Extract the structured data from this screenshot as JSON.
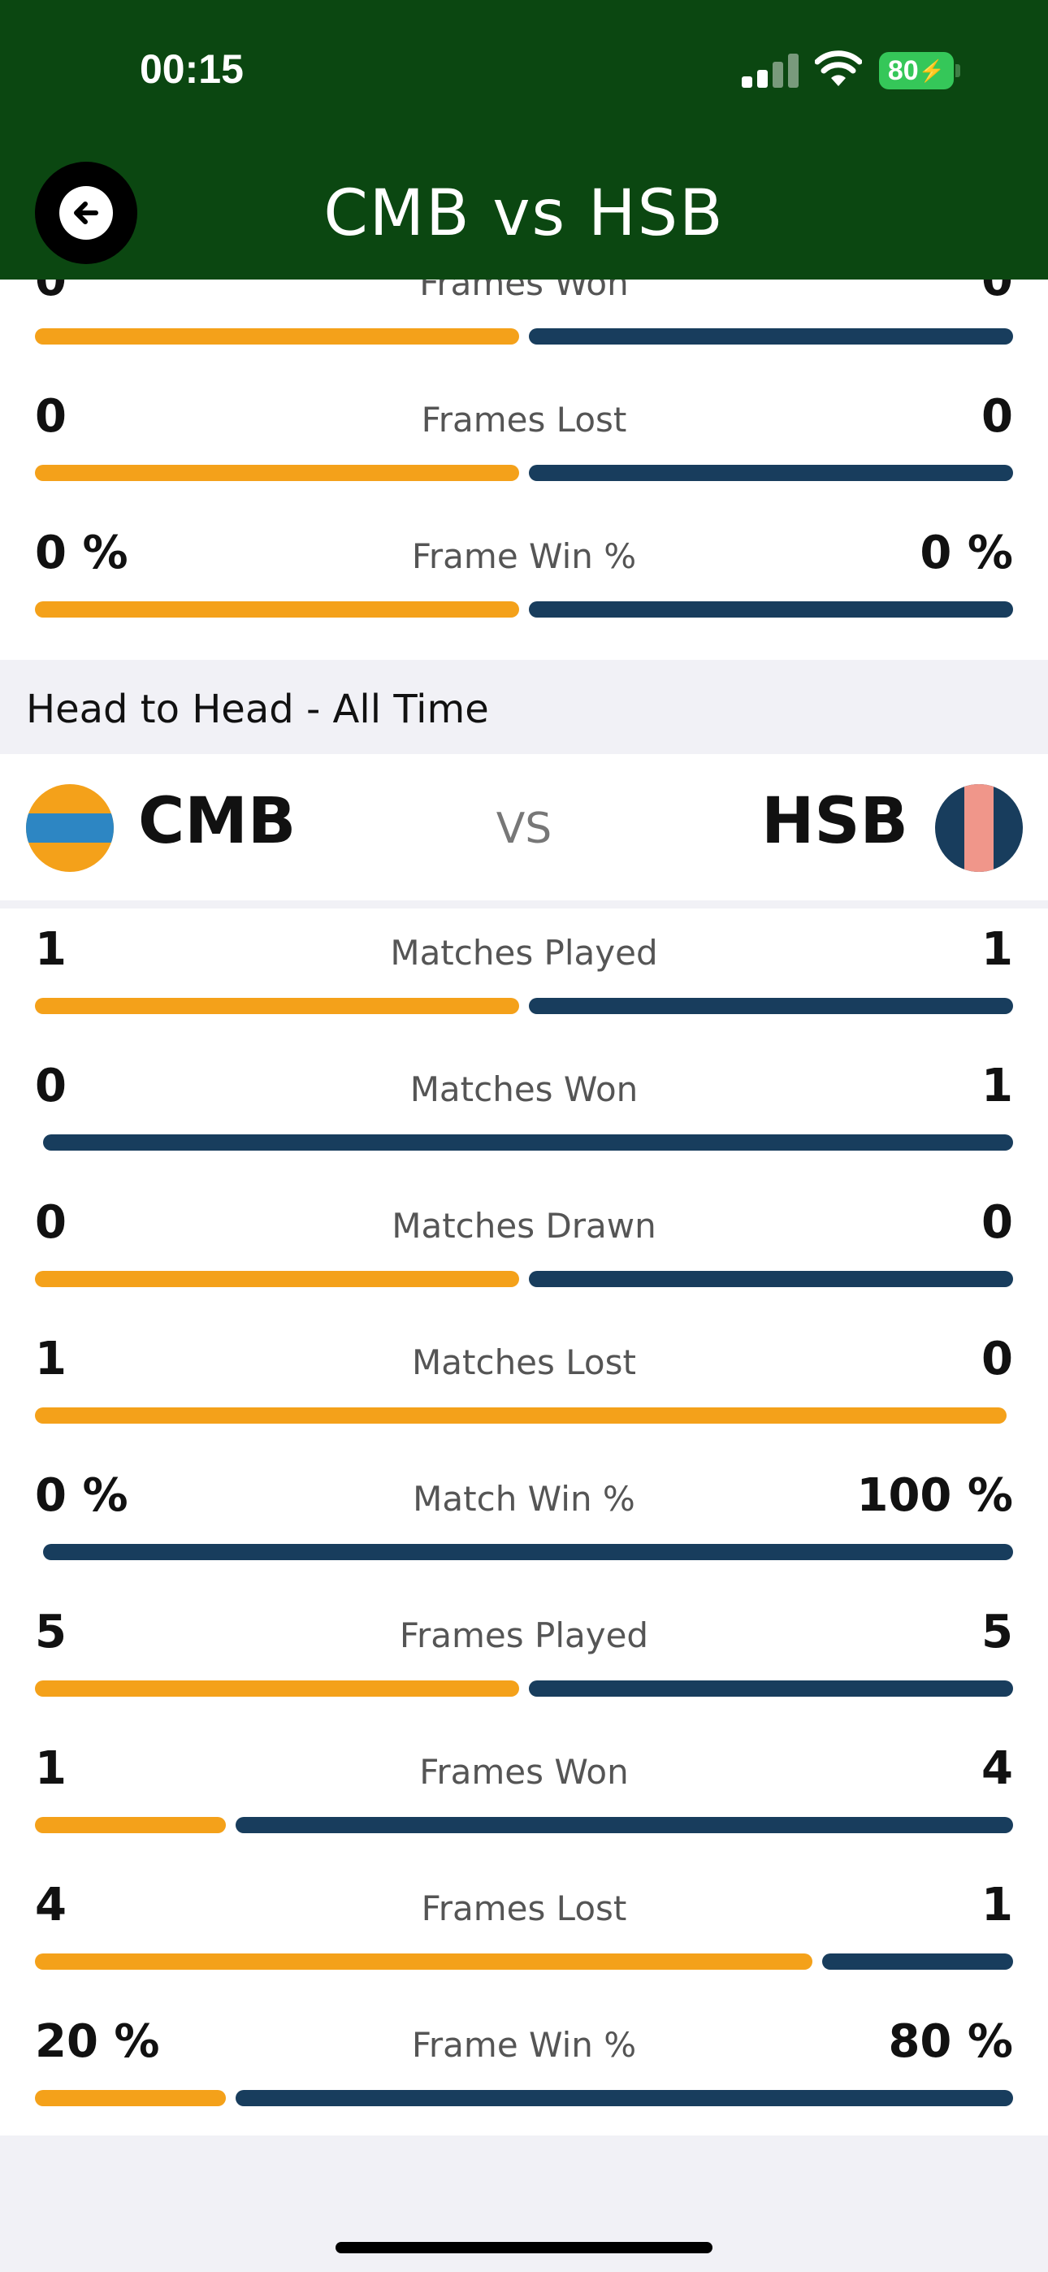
{
  "status_bar": {
    "time": "00:15",
    "battery": "80"
  },
  "header": {
    "title": "CMB vs HSB",
    "back_icon": "arrow-left-icon"
  },
  "colors": {
    "home": "#f4a11a",
    "away": "#183d5d",
    "header_bg": "#0b4711"
  },
  "season_stats": [
    {
      "label": "Frames Won",
      "left": "0",
      "right": "0",
      "home_share": 0.5
    },
    {
      "label": "Frames Lost",
      "left": "0",
      "right": "0",
      "home_share": 0.5
    },
    {
      "label": "Frame Win %",
      "left": "0 %",
      "right": "0 %",
      "home_share": 0.5
    }
  ],
  "h2h": {
    "section_title": "Head to Head - All Time",
    "home_team": "CMB",
    "away_team": "HSB",
    "vs": "VS",
    "stats": [
      {
        "label": "Matches Played",
        "left": "1",
        "right": "1",
        "home_share": 0.5
      },
      {
        "label": "Matches Won",
        "left": "0",
        "right": "1",
        "home_share": 0
      },
      {
        "label": "Matches Drawn",
        "left": "0",
        "right": "0",
        "home_share": 0.5
      },
      {
        "label": "Matches Lost",
        "left": "1",
        "right": "0",
        "home_share": 1
      },
      {
        "label": "Match Win %",
        "left": "0 %",
        "right": "100 %",
        "home_share": 0
      },
      {
        "label": "Frames Played",
        "left": "5",
        "right": "5",
        "home_share": 0.5
      },
      {
        "label": "Frames Won",
        "left": "1",
        "right": "4",
        "home_share": 0.2
      },
      {
        "label": "Frames Lost",
        "left": "4",
        "right": "1",
        "home_share": 0.8
      },
      {
        "label": "Frame Win %",
        "left": "20 %",
        "right": "80 %",
        "home_share": 0.2
      }
    ]
  }
}
